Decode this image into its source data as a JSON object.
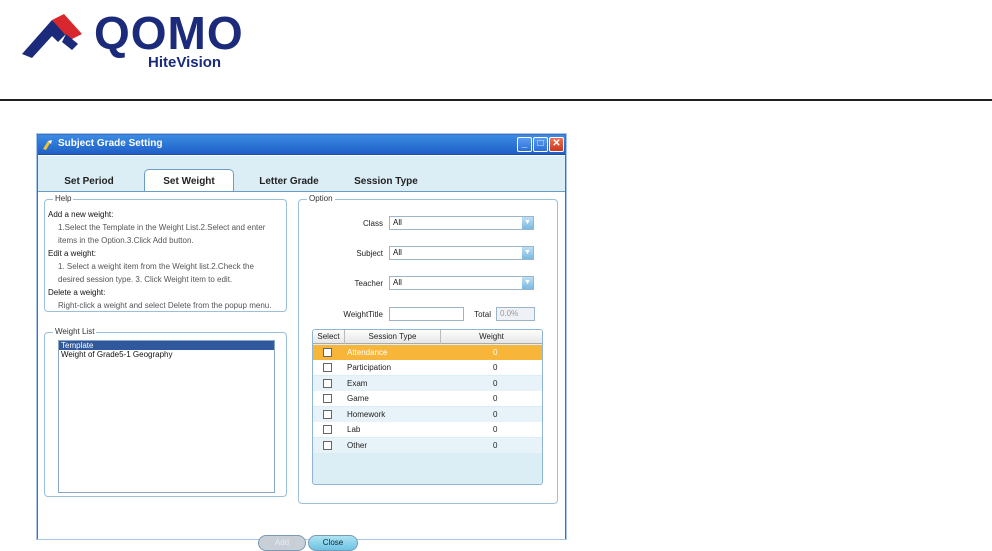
{
  "brand": {
    "name": "QOMO",
    "tagline": "HiteVision",
    "colors": {
      "primary": "#1b2a7a",
      "accent": "#d8282e"
    }
  },
  "window": {
    "title": "Subject Grade Setting",
    "controls": {
      "minimize": "_",
      "maximize": "□",
      "close": "✕"
    }
  },
  "tabs": [
    {
      "label": "Set Period"
    },
    {
      "label": "Set Weight",
      "active": true
    },
    {
      "label": "Letter Grade"
    },
    {
      "label": "Session Type"
    }
  ],
  "help": {
    "legend": "Help",
    "add_heading": "Add a new weight:",
    "add_step1": "1.Select the Template in the Weight List.2.Select and enter",
    "add_step2": "items in the Option.3.Click Add button.",
    "edit_heading": "Edit a weight:",
    "edit_step1": "1. Select a weight item from the Weight list.2.Check the",
    "edit_step2": "desired session type. 3. Click Weight item to edit.",
    "delete_heading": "Delete a weight:",
    "delete_step1": "Right-click a weight and select Delete from the popup menu."
  },
  "weight_list": {
    "legend": "Weight List",
    "items": [
      {
        "label": "Template",
        "selected": true
      },
      {
        "label": "Weight of Grade5-1 Geography"
      }
    ]
  },
  "option": {
    "legend": "Option",
    "class_label": "Class",
    "class_value": "All",
    "subject_label": "Subject",
    "subject_value": "All",
    "teacher_label": "Teacher",
    "teacher_value": "All",
    "weight_title_label": "WeightTitle",
    "weight_title_value": "",
    "total_label": "Total",
    "total_value": "0.0%"
  },
  "session_grid": {
    "headers": {
      "select": "Select",
      "type": "Session Type",
      "weight": "Weight"
    },
    "rows": [
      {
        "type": "Attendance",
        "weight": "0",
        "selected": true
      },
      {
        "type": "Participation",
        "weight": "0"
      },
      {
        "type": "Exam",
        "weight": "0"
      },
      {
        "type": "Game",
        "weight": "0"
      },
      {
        "type": "Homework",
        "weight": "0"
      },
      {
        "type": "Lab",
        "weight": "0"
      },
      {
        "type": "Other",
        "weight": "0"
      }
    ]
  },
  "buttons": {
    "add_label": "Add",
    "close_label": "Close"
  }
}
